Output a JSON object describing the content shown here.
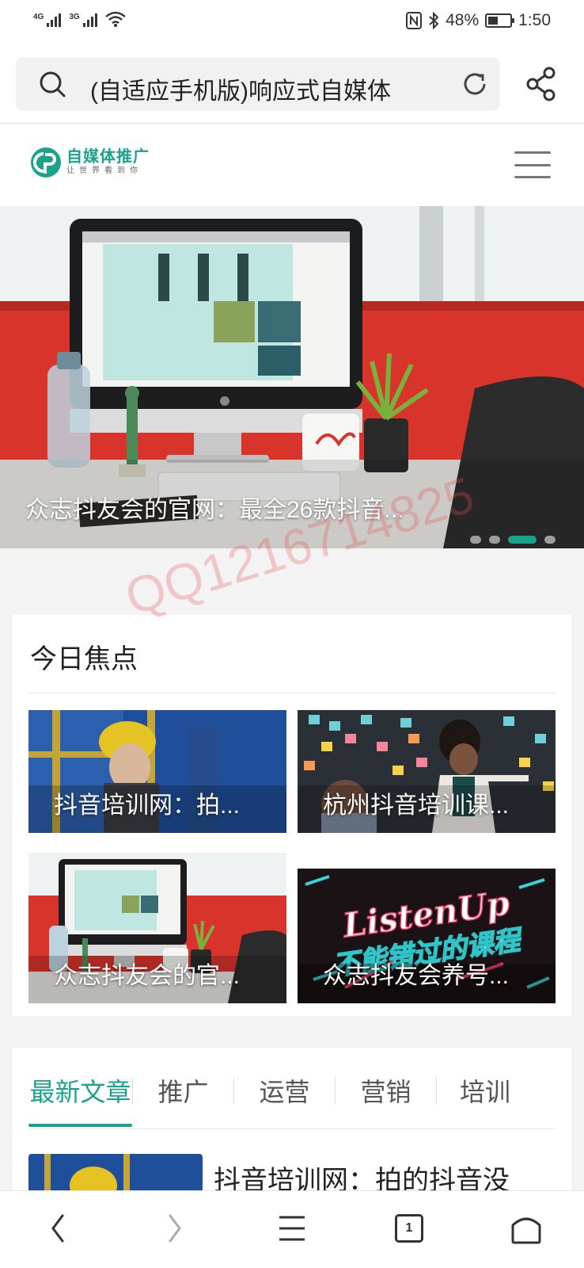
{
  "status_bar": {
    "network_1": "4G",
    "network_2": "3G",
    "battery": "48%",
    "time": "1:50",
    "icons": [
      "signal-icon",
      "wifi-icon",
      "nfc-icon",
      "bluetooth-icon",
      "battery-icon"
    ]
  },
  "address_bar": {
    "url_text": "(自适应手机版)响应式自媒体",
    "icons": [
      "search-icon",
      "reload-icon",
      "share-icon"
    ]
  },
  "site_header": {
    "logo_title": "自媒体推广",
    "logo_subtitle": "让世界看到你",
    "icons": [
      "logo-mark-icon",
      "hamburger-menu-icon"
    ]
  },
  "banner": {
    "caption": "众志抖友会的官网：最全26款抖音...",
    "slide_count": 4,
    "active_slide": 3
  },
  "watermark": "QQ1216714825",
  "focus": {
    "title": "今日焦点",
    "tiles": [
      {
        "caption": "抖音培训网：拍..."
      },
      {
        "caption": "杭州抖音培训课..."
      },
      {
        "caption": "众志抖友会的官..."
      },
      {
        "caption": "众志抖友会养号..."
      }
    ],
    "promo_text_1": "ListenUp",
    "promo_text_2": "不能错过的课程"
  },
  "articles": {
    "tabs": [
      "最新文章",
      "推广",
      "运营",
      "营销",
      "培训"
    ],
    "active_tab": 0,
    "first_title": "抖音培训网：拍的抖音没"
  },
  "bottom_nav": {
    "tab_count": "1",
    "icons": [
      "back-icon",
      "forward-icon",
      "menu-icon",
      "tabs-icon",
      "home-icon"
    ]
  },
  "colors": {
    "accent": "#1aa38c",
    "banner_red": "#d9342b",
    "watermark": "#e65050"
  }
}
